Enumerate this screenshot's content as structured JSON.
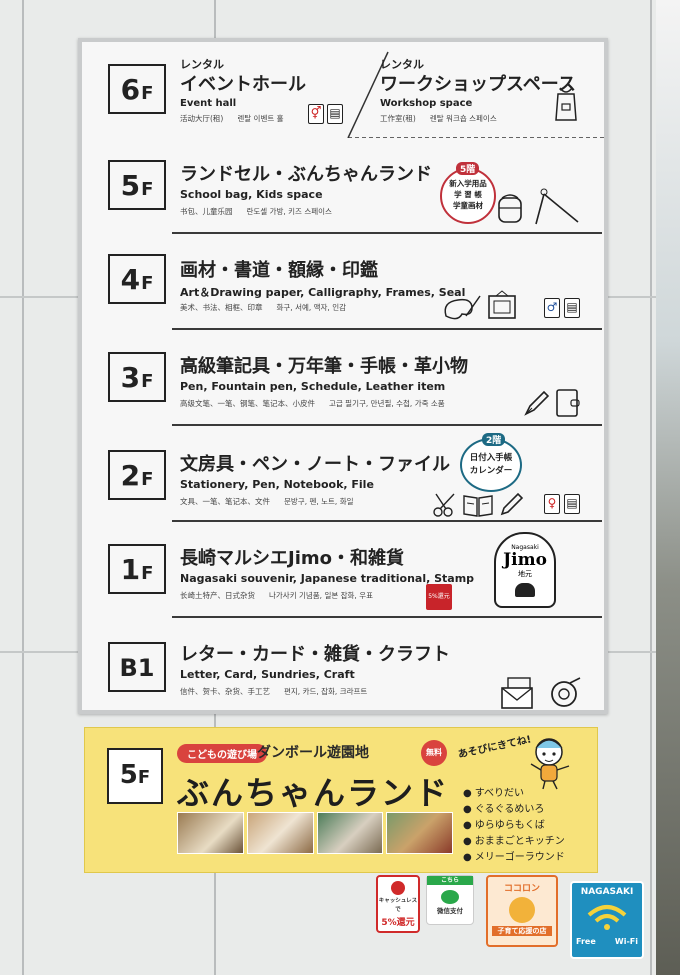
{
  "floors": [
    {
      "num": "6",
      "unit": "F",
      "left": {
        "rental": "レンタル",
        "ja": "イベントホール",
        "en": "Event hall",
        "sub": [
          "活动大厅(租)",
          "렌탈 이벤트 홀"
        ]
      },
      "right": {
        "rental": "レンタル",
        "ja": "ワークショップスペース",
        "en": "Workshop space",
        "sub": [
          "工作室(租)",
          "렌탈 워크숍 스페이스"
        ]
      },
      "icons": [
        "restroom-icon",
        "elevator-icon",
        "apron-icon"
      ]
    },
    {
      "num": "5",
      "unit": "F",
      "ja": "ランドセル・ぶんちゃんランド",
      "en": "School bag, Kids space",
      "sub": [
        "书包、儿童乐园",
        "란도셀 가방, 키즈 스페이스"
      ],
      "bubble": {
        "top": "5階",
        "lines": [
          "新入学用品",
          "学 習 帳",
          "学童画材"
        ]
      },
      "icons": [
        "school-bag-icon",
        "slide-icon"
      ]
    },
    {
      "num": "4",
      "unit": "F",
      "ja": "画材・書道・額縁・印鑑",
      "en": "Art＆Drawing paper, Calligraphy, Frames, Seal",
      "sub": [
        "美术、书法、相框、印章",
        "화구, 서예, 액자, 인감"
      ],
      "icons": [
        "palette-icon",
        "frame-icon",
        "restroom-icon",
        "elevator-icon"
      ]
    },
    {
      "num": "3",
      "unit": "F",
      "ja": "高級筆記具・万年筆・手帳・革小物",
      "en": "Pen, Fountain pen, Schedule, Leather item",
      "sub": [
        "高级文笔、一笔、钢笔、笔记本、小皮件",
        "고급 필기구, 만년필, 수첩, 가죽 소품"
      ],
      "icons": [
        "fountain-pen-icon",
        "notebook-icon"
      ]
    },
    {
      "num": "2",
      "unit": "F",
      "ja": "文房具・ペン・ノート・ファイル",
      "en": "Stationery, Pen, Notebook, File",
      "sub": [
        "文具、一笔、笔记本、文件",
        "문방구, 펜, 노트, 화일"
      ],
      "bubble": {
        "top": "2階",
        "lines": [
          "日付入手帳",
          "カレンダー"
        ]
      },
      "icons": [
        "scissors-icon",
        "book-icon",
        "pencil-icon",
        "restroom-icon",
        "elevator-icon"
      ]
    },
    {
      "num": "1",
      "unit": "F",
      "ja": "長崎マルシエJimo・和雑貨",
      "en": "Nagasaki souvenir, Japanese traditional, Stamp",
      "sub": [
        "长崎土特产、日式杂货",
        "나가사키 기념품, 일본 잡화, 우표"
      ],
      "logo": {
        "top": "Nagasaki",
        "main": "Jimo",
        "bottom": "地元"
      },
      "cashless": "5%還元",
      "icons": [
        "jimo-logo-icon",
        "cashless-sticker-icon"
      ]
    },
    {
      "num": "B1",
      "unit": "",
      "ja": "レター・カード・雑貨・クラフト",
      "en": "Letter, Card, Sundries, Craft",
      "sub": [
        "信件、贺卡、杂货、手工艺",
        "편지, 카드, 잡화, 크라프트"
      ],
      "icons": [
        "letter-icon",
        "tape-icon"
      ]
    }
  ],
  "promo": {
    "floor_num": "5",
    "floor_unit": "F",
    "tag": "こどもの遊び場",
    "subtitle": "ダンボール遊園地",
    "free": "無料",
    "title": "ぶんちゃんランド",
    "callout": "あそびにきてね!",
    "rides": [
      "すべりだい",
      "ぐるぐるめいろ",
      "ゆらゆらもくば",
      "おままごとキッチン",
      "メリーゴーラウンド"
    ]
  },
  "stickers": {
    "cashless": {
      "top": "キャッシュレスで",
      "main": "5%還元"
    },
    "pay": {
      "top": "こちら",
      "main": "微信支付"
    },
    "koro": {
      "top": "ココロン",
      "main": "子育て応援の店"
    },
    "wifi": {
      "top": "NAGASAKI",
      "left": "Free",
      "right": "Wi-Fi"
    }
  },
  "colors": {
    "accent_red": "#c0313b",
    "accent_blue": "#1d6a84",
    "promo_yellow": "#f7e27a",
    "wifi_blue": "#1f8fbf"
  }
}
